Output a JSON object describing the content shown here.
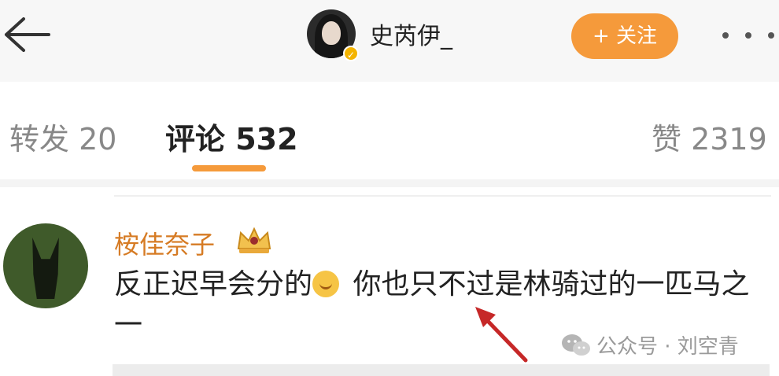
{
  "header": {
    "username": "史芮伊_",
    "follow_label": "+ 关注"
  },
  "tabs": {
    "repost_label": "转发 20",
    "comments_label": "评论 532",
    "likes_label": "赞 2319"
  },
  "comment": {
    "username": "桉佳奈子",
    "text_part1": "反正迟早会分的",
    "text_part2": " 你也只不过是林骑过的一匹马之一"
  },
  "watermark": {
    "text": "公众号 · 刘空青"
  },
  "colors": {
    "accent": "#f59a3b",
    "username_orange": "#d67b24",
    "arrow_red": "#c62828"
  }
}
